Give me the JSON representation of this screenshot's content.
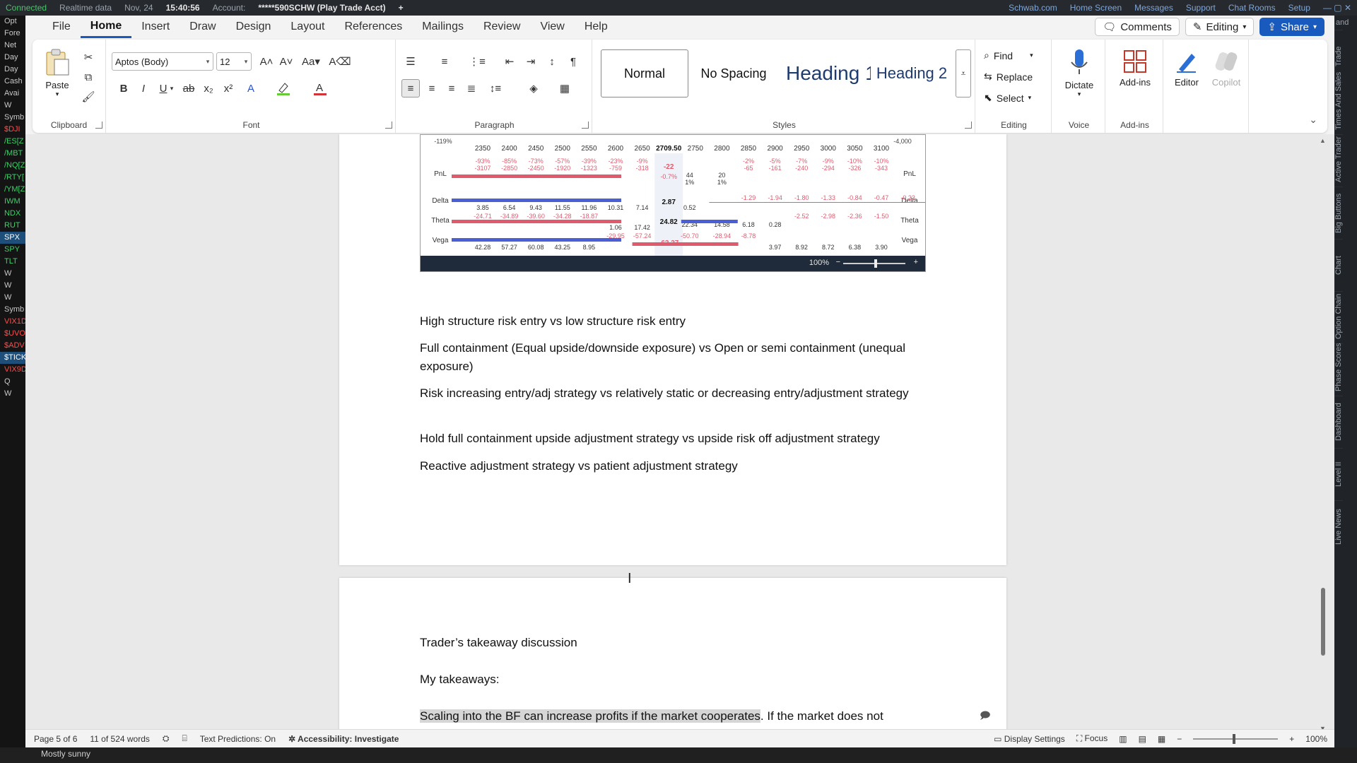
{
  "platform": {
    "status": "Connected",
    "data_feed": "Realtime data",
    "date": "Nov, 24",
    "time": "15:40:56",
    "account_label": "Account:",
    "account": "*****590SCHW (Play Trade Acct)",
    "links": [
      "Schwab.com",
      "Home Screen",
      "Messages",
      "Support",
      "Chat Rooms",
      "Setup"
    ],
    "left_rows": [
      "Opt",
      "Fore",
      "Net",
      "Day",
      "Day",
      "Cash",
      "Avai",
      "W",
      "Symb",
      "$DJI",
      "/ES[Z",
      "/MBT",
      "/NQ[Z",
      "/RTY[",
      "/YM[Z",
      "IWM",
      "NDX",
      "RUT",
      "SPX",
      "SPY",
      "TLT",
      "W",
      "W",
      "W",
      "Symb",
      "VIX1D",
      "$UVO",
      "$ADV",
      "$TICK",
      "VIX9D",
      "Q",
      "W"
    ],
    "right_tabs": [
      "Trade",
      "Times And Sales",
      "Active Trader",
      "Big Buttons",
      "Chart",
      "Option Chain",
      "Phase Scores",
      "Dashboard",
      "Level II",
      "Live News"
    ],
    "right_top": "and"
  },
  "word": {
    "menu_tabs": [
      "File",
      "Home",
      "Insert",
      "Draw",
      "Design",
      "Layout",
      "References",
      "Mailings",
      "Review",
      "View",
      "Help"
    ],
    "active_tab": "Home",
    "comments_label": "Comments",
    "editing_label": "Editing",
    "share_label": "Share",
    "ribbon": {
      "clipboard": {
        "label": "Clipboard",
        "paste": "Paste"
      },
      "font": {
        "label": "Font",
        "font_name": "Aptos (Body)",
        "font_size": "12"
      },
      "paragraph": {
        "label": "Paragraph"
      },
      "styles": {
        "label": "Styles",
        "normal": "Normal",
        "no_spacing": "No Spacing",
        "heading1": "Heading 1",
        "heading2": "Heading 2"
      },
      "editing": {
        "label": "Editing",
        "find": "Find",
        "replace": "Replace",
        "select": "Select"
      },
      "voice": {
        "label": "Voice",
        "dictate": "Dictate"
      },
      "addins": {
        "label": "Add-ins",
        "addins_btn": "Add-ins"
      },
      "editor": "Editor",
      "copilot": "Copilot"
    },
    "risk_profile": {
      "top_left": "-119%",
      "top_right": "-4,000",
      "strikes": [
        "2350",
        "2400",
        "2450",
        "2500",
        "2550",
        "2600",
        "2650",
        "2709.50",
        "2750",
        "2800",
        "2850",
        "2900",
        "2950",
        "3000",
        "3050",
        "3100"
      ],
      "row_labels": [
        "PnL",
        "Delta",
        "Theta",
        "Vega"
      ],
      "pnl_pct_left": [
        "-93%",
        "-85%",
        "-73%",
        "-57%",
        "-39%",
        "-23%",
        "-9%"
      ],
      "pnl_val_left": [
        "-3107",
        "-2850",
        "-2450",
        "-1920",
        "-1323",
        "-759",
        "-318"
      ],
      "pnl_pct_right": [
        "-2%",
        "-5%",
        "-7%",
        "-9%",
        "-10%",
        "-10%"
      ],
      "pnl_val_right": [
        "-65",
        "-161",
        "-240",
        "-294",
        "-326",
        "-343"
      ],
      "center_pnl": "-22",
      "center_pnl_pct": "-0.7%",
      "near_right_a": [
        "44",
        "1%"
      ],
      "near_right_b": [
        "20",
        "1%"
      ],
      "delta_left": [
        "3.85",
        "6.54",
        "9.43",
        "11.55",
        "11.96",
        "10.31",
        "7.14"
      ],
      "delta_center": "2.87",
      "delta_right": [
        "0.52",
        "-1.29",
        "-1.94",
        "-1.80",
        "-1.33",
        "-0.84",
        "-0.47",
        "-0.23"
      ],
      "theta_left": [
        "-24.71",
        "-34.89",
        "-39.60",
        "-34.28",
        "-18.87",
        "1.06",
        "17.42"
      ],
      "theta_center": "24.82",
      "theta_right": [
        "22.34",
        "14.58",
        "6.18",
        "0.28",
        "-2.52",
        "-2.98",
        "-2.36",
        "-1.50"
      ],
      "vega_left": [
        "42.28",
        "57.27",
        "60.08",
        "43.25",
        "8.95",
        "-29.95",
        "-57.24"
      ],
      "vega_center": "-62.27",
      "vega_right": [
        "-50.70",
        "-28.94",
        "-8.78",
        "3.97",
        "8.92",
        "8.72",
        "6.38",
        "3.90"
      ],
      "zoom": "100%"
    },
    "page1_paragraphs": [
      "High structure risk entry vs low structure risk entry",
      "Full containment (Equal upside/downside exposure) vs Open or semi containment (unequal exposure)",
      "Risk increasing entry/adj strategy vs relatively static or decreasing entry/adjustment strategy",
      "Hold full containment upside adjustment strategy vs upside risk off adjustment strategy",
      "Reactive adjustment strategy vs patient adjustment strategy"
    ],
    "page2_title": "Trader’s takeaway discussion",
    "page2_subtitle": "My takeaways:",
    "page2_highlight": "Scaling into the BF can increase profits if the market cooperates",
    "page2_rest": ". If the market does not",
    "status": {
      "page": "Page 5 of 6",
      "words": "11 of 524 words",
      "text_predictions": "Text Predictions: On",
      "accessibility": "Accessibility: Investigate",
      "display_settings": "Display Settings",
      "focus": "Focus",
      "zoom": "100%"
    }
  },
  "taskbar": {
    "weather": "Mostly sunny"
  },
  "colors": {
    "accent": "#185abd",
    "pnl_neg": "#e05a6e",
    "bar_pos": "#4a5fd6"
  }
}
